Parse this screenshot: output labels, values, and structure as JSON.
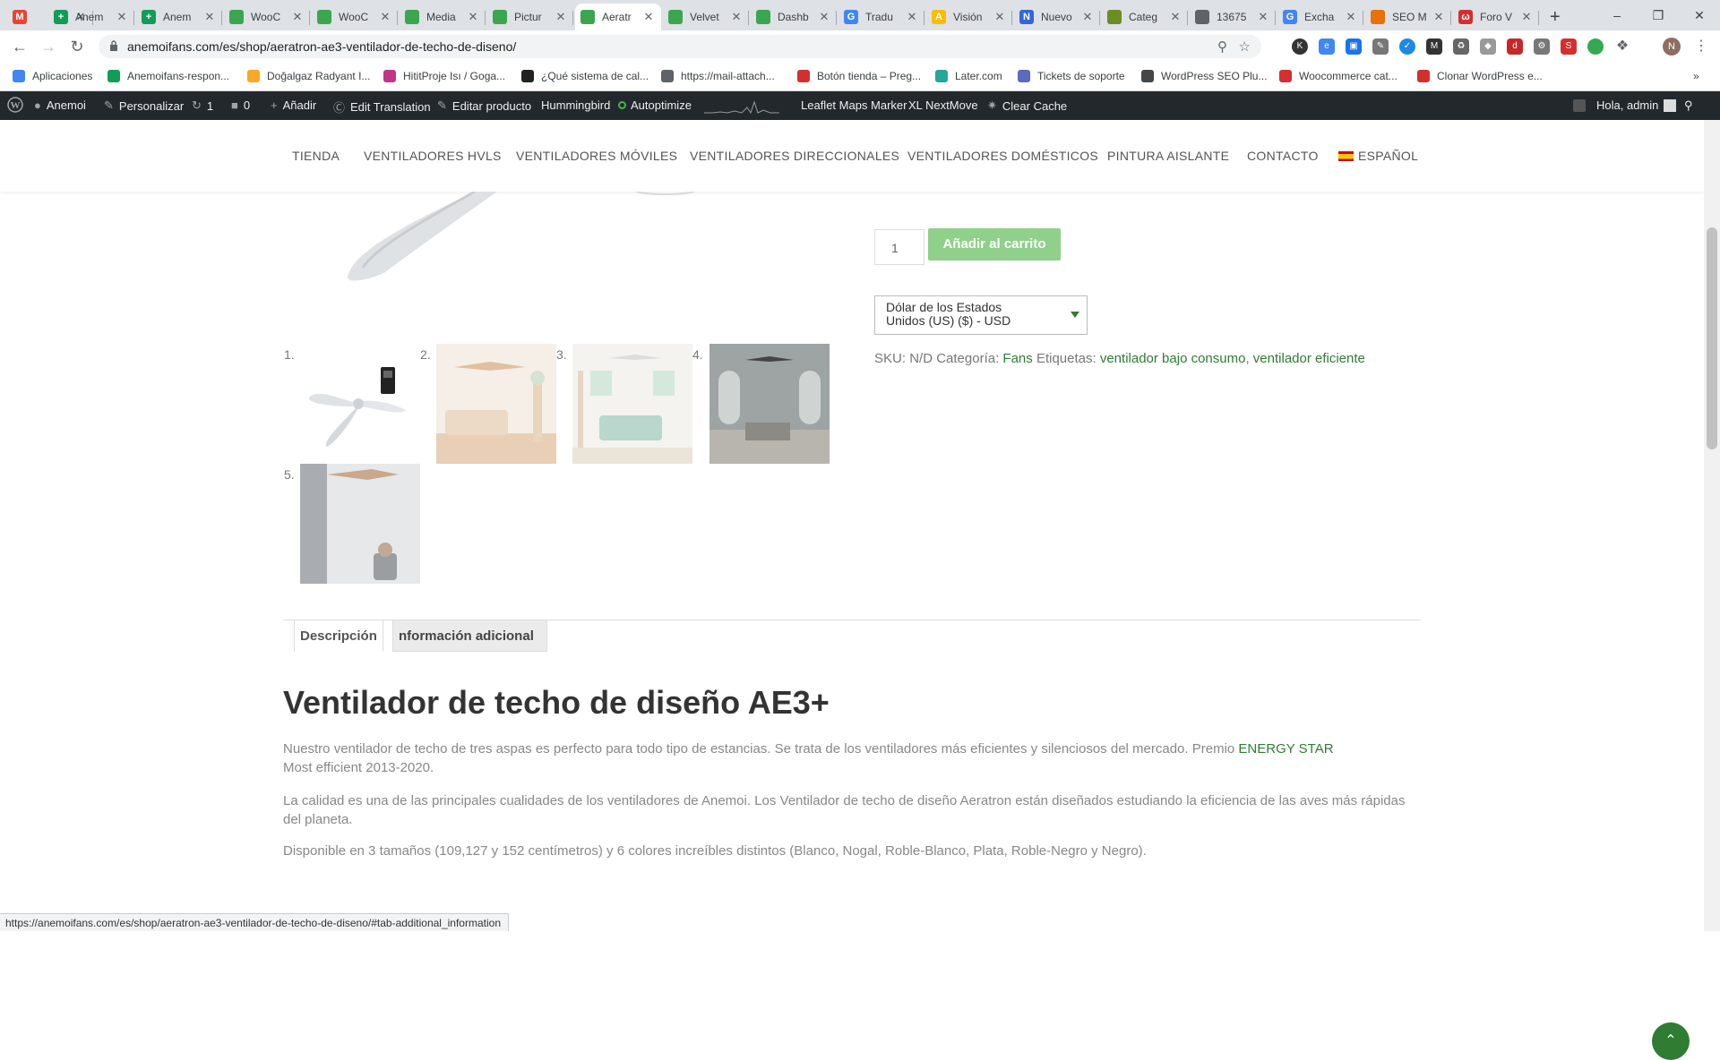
{
  "browser": {
    "tabs": [
      {
        "title": "",
        "fav": "M",
        "favColor": "#ea4335"
      },
      {
        "title": "Anem",
        "fav": "+",
        "favColor": "#0f9d58"
      },
      {
        "title": "Anem",
        "fav": "+",
        "favColor": "#0f9d58"
      },
      {
        "title": "WooC",
        "fav": "",
        "favColor": "#3ca54f"
      },
      {
        "title": "WooC",
        "fav": "",
        "favColor": "#3ca54f"
      },
      {
        "title": "Media",
        "fav": "",
        "favColor": "#3ca54f"
      },
      {
        "title": "Pictur",
        "fav": "",
        "favColor": "#3ca54f"
      },
      {
        "title": "Aeratr",
        "fav": "",
        "favColor": "#3ca54f"
      },
      {
        "title": "Velvet",
        "fav": "",
        "favColor": "#3ca54f"
      },
      {
        "title": "Dashb",
        "fav": "",
        "favColor": "#3ca54f"
      },
      {
        "title": "Tradu",
        "fav": "G",
        "favColor": "#4285f4"
      },
      {
        "title": "Visión",
        "fav": "A",
        "favColor": "#fbbc04"
      },
      {
        "title": "Nuevo",
        "fav": "N",
        "favColor": "#3367d6"
      },
      {
        "title": "Categ",
        "fav": "",
        "favColor": "#6b8e23"
      },
      {
        "title": "13675",
        "fav": "",
        "favColor": "#5f6368"
      },
      {
        "title": "Excha",
        "fav": "G",
        "favColor": "#4285f4"
      },
      {
        "title": "SEO M",
        "fav": "",
        "favColor": "#e8710a"
      },
      {
        "title": "Foro V",
        "fav": "ω",
        "favColor": "#d32f2f"
      }
    ],
    "active_tab_index": 7,
    "new_tab": "+",
    "url": "anemoifans.com/es/shop/aeratron-ae3-ventilador-de-techo-de-diseno/",
    "profile_initial": "N",
    "bookmarks": [
      {
        "label": "Aplicaciones",
        "color": "#4285f4"
      },
      {
        "label": "Anemoifans-respon...",
        "color": "#0f9d58"
      },
      {
        "label": "Doğalgaz Radyant I...",
        "color": "#f9a825"
      },
      {
        "label": "HititProje Isı / Goga...",
        "color": "#c13584"
      },
      {
        "label": "¿Qué sistema de cal...",
        "color": "#222"
      },
      {
        "label": "https://mail-attach...",
        "color": "#5f6368"
      },
      {
        "label": "Botón tienda – Preg...",
        "color": "#d32f2f"
      },
      {
        "label": "Later.com",
        "color": "#26a69a"
      },
      {
        "label": "Tickets de soporte",
        "color": "#5c6bc0"
      },
      {
        "label": "WordPress SEO Plu...",
        "color": "#464646"
      },
      {
        "label": "Woocommerce cat...",
        "color": "#d32f2f"
      },
      {
        "label": "Clonar WordPress e...",
        "color": "#d32f2f"
      }
    ]
  },
  "adminbar": {
    "items": [
      "Anemoi",
      "Personalizar",
      "1",
      "0",
      "Añadir",
      "Edit Translation",
      "Editar producto",
      "Hummingbird",
      "Autoptimize",
      "Leaflet Maps Marker",
      "XL NextMove",
      "Clear Cache"
    ],
    "greeting": "Hola, admin"
  },
  "site": {
    "menu": [
      "TIENDA",
      "VENTILADORES HVLS",
      "VENTILADORES MÓVILES",
      "VENTILADORES DIRECCIONALES",
      "VENTILADORES DOMÉSTICOS",
      "PINTURA AISLANTE",
      "CONTACTO",
      "ESPAÑOL"
    ]
  },
  "product": {
    "quantity": "1",
    "add_to_cart": "Añadir al carrito",
    "currency_line1": "Dólar de los Estados",
    "currency_line2": "Unidos (US) ($) - USD",
    "sku_label": "SKU:",
    "sku_value": "N/D",
    "category_label": "Categoría:",
    "category_value": "Fans",
    "tags_label": "Etiquetas:",
    "tag1": "ventilador bajo consumo",
    "tag2": "ventilador eficiente",
    "thumbnails": [
      "1.",
      "2.",
      "3.",
      "4.",
      "5."
    ],
    "tabs": [
      "Descripción",
      "nformación adicional"
    ],
    "title": "Ventilador de techo de diseño AE3+",
    "p1_text": "Nuestro ventilador de techo de tres aspas es perfecto para todo tipo de estancias. Se trata de los ventiladores más eficientes y silenciosos del mercado. Premio ",
    "p1_link": "ENERGY STAR",
    "p1_after": "Most efficient 2013-2020.",
    "p2": "La calidad es una de las principales cualidades de los ventiladores de Anemoi. Los Ventilador de techo de diseño Aeratron están diseñados estudiando la eficiencia de las aves más rápidas del planeta.",
    "p3": "Disponible en 3 tamaños (109,127 y 152 centímetros) y 6 colores increíbles distintos (Blanco, Nogal, Roble-Blanco, Plata, Roble-Negro y Negro)."
  },
  "status_url": "https://anemoifans.com/es/shop/aeratron-ae3-ventilador-de-techo-de-diseno/#tab-additional_information"
}
